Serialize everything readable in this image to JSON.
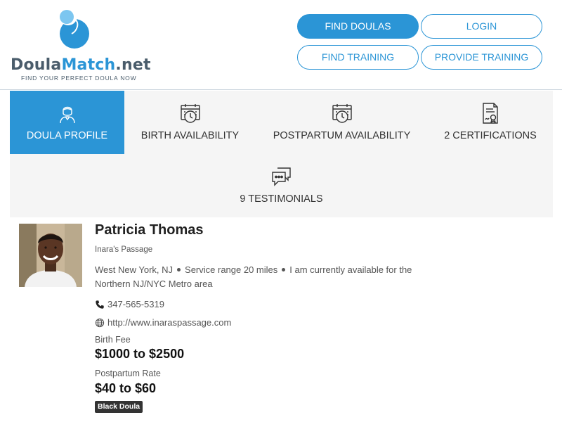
{
  "logo": {
    "word_part1": "Doula",
    "word_part2": "Match",
    "word_part3": ".net",
    "tagline": "FIND YOUR PERFECT DOULA NOW"
  },
  "nav": {
    "find_doulas": "FIND DOULAS",
    "login": "LOGIN",
    "find_training": "FIND TRAINING",
    "provide_training": "PROVIDE TRAINING"
  },
  "tabs": [
    {
      "label": "DOULA PROFILE",
      "icon": "doula-person-icon",
      "active": true
    },
    {
      "label": "BIRTH AVAILABILITY",
      "icon": "calendar-clock-icon",
      "active": false
    },
    {
      "label": "POSTPARTUM AVAILABILITY",
      "icon": "calendar-clock-icon",
      "active": false
    },
    {
      "label": "2 CERTIFICATIONS",
      "icon": "certificate-icon",
      "active": false
    },
    {
      "label": "9 TESTIMONIALS",
      "icon": "chat-bubbles-icon",
      "active": false
    }
  ],
  "profile": {
    "name": "Patricia Thomas",
    "agency": "Inara's Passage",
    "location": "West New York, NJ",
    "service_range": "Service range 20 miles",
    "availability_line1": "I am currently available for the",
    "availability_line2": "Northern NJ/NYC Metro area",
    "phone": "347-565-5319",
    "website": "http://www.inaraspassage.com",
    "birth_fee_label": "Birth Fee",
    "birth_fee": "$1000 to $2500",
    "postpartum_label": "Postpartum Rate",
    "postpartum_rate": "$40 to $60",
    "badge": "Black Doula"
  },
  "colors": {
    "accent": "#2b95d6",
    "tab_bg": "#f5f5f5",
    "text_dark": "#222222",
    "text_muted": "#555555",
    "badge_bg": "#333333"
  }
}
